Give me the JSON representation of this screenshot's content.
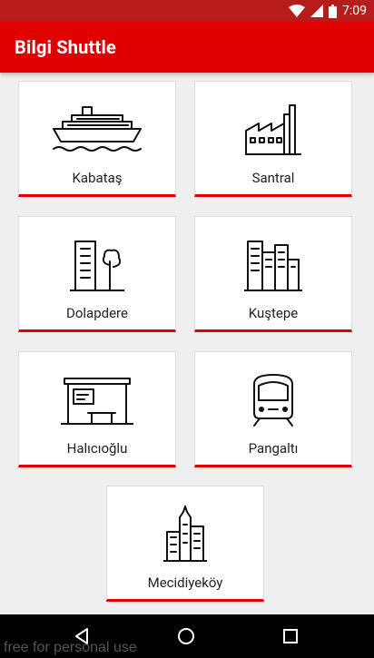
{
  "status_bar": {
    "time": "7:09",
    "icons": [
      "wifi-icon",
      "signal-icon",
      "battery-icon"
    ]
  },
  "app_bar": {
    "title": "Bilgi Shuttle"
  },
  "tiles": [
    {
      "label": "Kabataş",
      "icon": "ship-icon"
    },
    {
      "label": "Santral",
      "icon": "factory-icon"
    },
    {
      "label": "Dolapdere",
      "icon": "building-tree-icon"
    },
    {
      "label": "Kuştepe",
      "icon": "city-buildings-icon"
    },
    {
      "label": "Halıcıoğlu",
      "icon": "bus-stop-icon"
    },
    {
      "label": "Pangaltı",
      "icon": "train-icon"
    },
    {
      "label": "Mecidiyeköy",
      "icon": "skyscrapers-icon"
    }
  ],
  "nav_bar": {
    "buttons": [
      "back-icon",
      "home-icon",
      "recents-icon"
    ]
  },
  "watermark": "free for personal use",
  "colors": {
    "accent": "#e00000",
    "status_bar": "#b71c1c",
    "background": "#efefef"
  }
}
